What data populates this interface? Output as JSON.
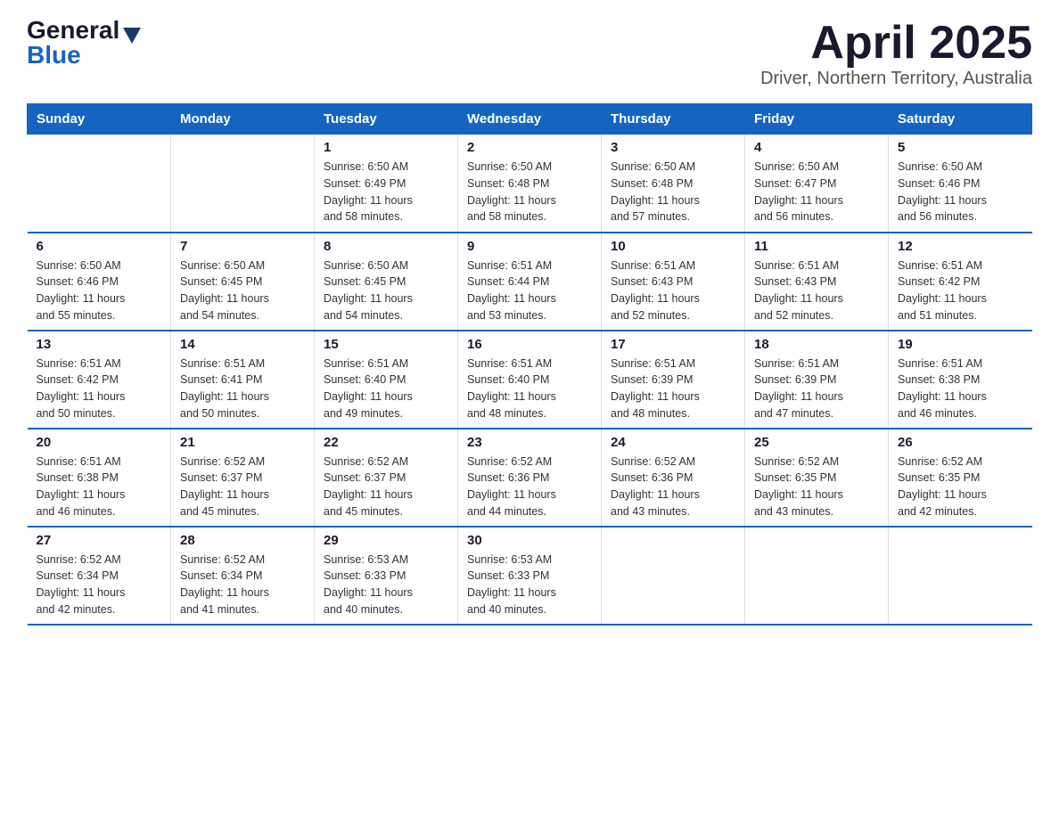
{
  "header": {
    "logo_general": "General",
    "logo_blue": "Blue",
    "title": "April 2025",
    "subtitle": "Driver, Northern Territory, Australia"
  },
  "days_of_week": [
    "Sunday",
    "Monday",
    "Tuesday",
    "Wednesday",
    "Thursday",
    "Friday",
    "Saturday"
  ],
  "weeks": [
    [
      {
        "day": "",
        "info": ""
      },
      {
        "day": "",
        "info": ""
      },
      {
        "day": "1",
        "info": "Sunrise: 6:50 AM\nSunset: 6:49 PM\nDaylight: 11 hours\nand 58 minutes."
      },
      {
        "day": "2",
        "info": "Sunrise: 6:50 AM\nSunset: 6:48 PM\nDaylight: 11 hours\nand 58 minutes."
      },
      {
        "day": "3",
        "info": "Sunrise: 6:50 AM\nSunset: 6:48 PM\nDaylight: 11 hours\nand 57 minutes."
      },
      {
        "day": "4",
        "info": "Sunrise: 6:50 AM\nSunset: 6:47 PM\nDaylight: 11 hours\nand 56 minutes."
      },
      {
        "day": "5",
        "info": "Sunrise: 6:50 AM\nSunset: 6:46 PM\nDaylight: 11 hours\nand 56 minutes."
      }
    ],
    [
      {
        "day": "6",
        "info": "Sunrise: 6:50 AM\nSunset: 6:46 PM\nDaylight: 11 hours\nand 55 minutes."
      },
      {
        "day": "7",
        "info": "Sunrise: 6:50 AM\nSunset: 6:45 PM\nDaylight: 11 hours\nand 54 minutes."
      },
      {
        "day": "8",
        "info": "Sunrise: 6:50 AM\nSunset: 6:45 PM\nDaylight: 11 hours\nand 54 minutes."
      },
      {
        "day": "9",
        "info": "Sunrise: 6:51 AM\nSunset: 6:44 PM\nDaylight: 11 hours\nand 53 minutes."
      },
      {
        "day": "10",
        "info": "Sunrise: 6:51 AM\nSunset: 6:43 PM\nDaylight: 11 hours\nand 52 minutes."
      },
      {
        "day": "11",
        "info": "Sunrise: 6:51 AM\nSunset: 6:43 PM\nDaylight: 11 hours\nand 52 minutes."
      },
      {
        "day": "12",
        "info": "Sunrise: 6:51 AM\nSunset: 6:42 PM\nDaylight: 11 hours\nand 51 minutes."
      }
    ],
    [
      {
        "day": "13",
        "info": "Sunrise: 6:51 AM\nSunset: 6:42 PM\nDaylight: 11 hours\nand 50 minutes."
      },
      {
        "day": "14",
        "info": "Sunrise: 6:51 AM\nSunset: 6:41 PM\nDaylight: 11 hours\nand 50 minutes."
      },
      {
        "day": "15",
        "info": "Sunrise: 6:51 AM\nSunset: 6:40 PM\nDaylight: 11 hours\nand 49 minutes."
      },
      {
        "day": "16",
        "info": "Sunrise: 6:51 AM\nSunset: 6:40 PM\nDaylight: 11 hours\nand 48 minutes."
      },
      {
        "day": "17",
        "info": "Sunrise: 6:51 AM\nSunset: 6:39 PM\nDaylight: 11 hours\nand 48 minutes."
      },
      {
        "day": "18",
        "info": "Sunrise: 6:51 AM\nSunset: 6:39 PM\nDaylight: 11 hours\nand 47 minutes."
      },
      {
        "day": "19",
        "info": "Sunrise: 6:51 AM\nSunset: 6:38 PM\nDaylight: 11 hours\nand 46 minutes."
      }
    ],
    [
      {
        "day": "20",
        "info": "Sunrise: 6:51 AM\nSunset: 6:38 PM\nDaylight: 11 hours\nand 46 minutes."
      },
      {
        "day": "21",
        "info": "Sunrise: 6:52 AM\nSunset: 6:37 PM\nDaylight: 11 hours\nand 45 minutes."
      },
      {
        "day": "22",
        "info": "Sunrise: 6:52 AM\nSunset: 6:37 PM\nDaylight: 11 hours\nand 45 minutes."
      },
      {
        "day": "23",
        "info": "Sunrise: 6:52 AM\nSunset: 6:36 PM\nDaylight: 11 hours\nand 44 minutes."
      },
      {
        "day": "24",
        "info": "Sunrise: 6:52 AM\nSunset: 6:36 PM\nDaylight: 11 hours\nand 43 minutes."
      },
      {
        "day": "25",
        "info": "Sunrise: 6:52 AM\nSunset: 6:35 PM\nDaylight: 11 hours\nand 43 minutes."
      },
      {
        "day": "26",
        "info": "Sunrise: 6:52 AM\nSunset: 6:35 PM\nDaylight: 11 hours\nand 42 minutes."
      }
    ],
    [
      {
        "day": "27",
        "info": "Sunrise: 6:52 AM\nSunset: 6:34 PM\nDaylight: 11 hours\nand 42 minutes."
      },
      {
        "day": "28",
        "info": "Sunrise: 6:52 AM\nSunset: 6:34 PM\nDaylight: 11 hours\nand 41 minutes."
      },
      {
        "day": "29",
        "info": "Sunrise: 6:53 AM\nSunset: 6:33 PM\nDaylight: 11 hours\nand 40 minutes."
      },
      {
        "day": "30",
        "info": "Sunrise: 6:53 AM\nSunset: 6:33 PM\nDaylight: 11 hours\nand 40 minutes."
      },
      {
        "day": "",
        "info": ""
      },
      {
        "day": "",
        "info": ""
      },
      {
        "day": "",
        "info": ""
      }
    ]
  ]
}
